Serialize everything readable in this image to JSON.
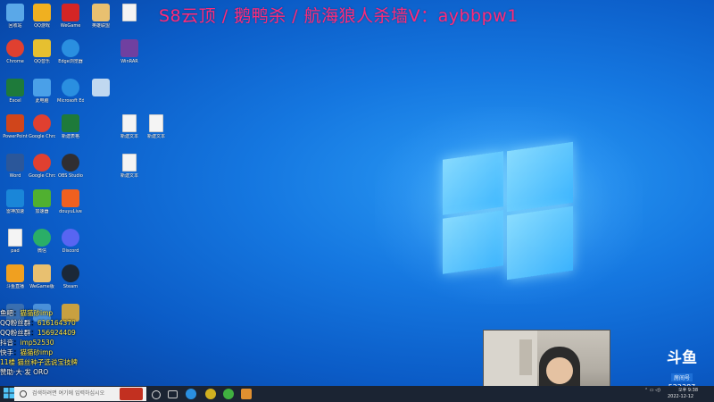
{
  "overlay": {
    "title": "S8云顶 / 鹅鸭杀 / 航海狼人杀墙V：aybbpw1",
    "lines": [
      {
        "label": "鱼吧",
        "value": "猫猫砂imp"
      },
      {
        "label": "QQ粉丝群",
        "value": "616164370"
      },
      {
        "label": "QQ粉丝群",
        "value": "156924409"
      },
      {
        "label": "抖音",
        "value": "imp52530"
      },
      {
        "label": "快手",
        "value": "猫猫砂imp"
      },
      {
        "label": "",
        "value": "11楼 猫丝种子选说宝技牌"
      },
      {
        "label": "",
        "value": "赞助·大·发 ORO"
      }
    ]
  },
  "desktop_icons": [
    {
      "name": "recycle-bin-icon",
      "label": "回收站",
      "color": "#5aa8e8"
    },
    {
      "name": "app-icon",
      "label": "QQ游戏",
      "color": "#f0b020"
    },
    {
      "name": "app-icon",
      "label": "WeGame",
      "color": "#d42525"
    },
    {
      "name": "app-icon",
      "label": "英雄联盟",
      "color": "#e8c070"
    },
    {
      "name": "file-icon",
      "label": "",
      "color": "#f4f4f4"
    },
    {
      "name": "chrome-icon",
      "label": "Chrome",
      "color": "#e04030"
    },
    {
      "name": "app-icon",
      "label": "QQ音乐",
      "color": "#e6c030"
    },
    {
      "name": "edge-icon",
      "label": "Edge浏览器",
      "color": "#2a8fe0"
    },
    {
      "name": "winrar-icon",
      "label": "WinRAR",
      "color": "#7040a0"
    },
    {
      "name": "excel-icon",
      "label": "Excel",
      "color": "#1e7a3a"
    },
    {
      "name": "computer-icon",
      "label": "此电脑",
      "color": "#4aa0e8"
    },
    {
      "name": "edge-icon",
      "label": "Microsoft Edge",
      "color": "#2a8fe0"
    },
    {
      "name": "app-icon",
      "label": "",
      "color": "#c0d8f0"
    },
    {
      "name": "powerpoint-icon",
      "label": "PowerPoint",
      "color": "#d0451b"
    },
    {
      "name": "chrome-icon",
      "label": "Google Chrome",
      "color": "#e04030"
    },
    {
      "name": "excel-icon",
      "label": "新建表格",
      "color": "#1e7a3a"
    },
    {
      "name": "file-icon",
      "label": "新建文本",
      "color": "#f4f4f4"
    },
    {
      "name": "file-icon",
      "label": "新建文本",
      "color": "#f4f4f4"
    },
    {
      "name": "word-icon",
      "label": "Word",
      "color": "#2b579a"
    },
    {
      "name": "chrome-icon",
      "label": "Google Chrome",
      "color": "#e04030"
    },
    {
      "name": "obs-icon",
      "label": "OBS Studio",
      "color": "#302e31"
    },
    {
      "name": "file-icon",
      "label": "新建文本",
      "color": "#f4f4f4"
    },
    {
      "name": "app-icon",
      "label": "雷神加速",
      "color": "#1a86d8"
    },
    {
      "name": "app-icon",
      "label": "加速器",
      "color": "#50b030"
    },
    {
      "name": "app-icon",
      "label": "douyuLive",
      "color": "#f06020"
    },
    {
      "name": "file-icon",
      "label": "pad",
      "color": "#f4f4f4"
    },
    {
      "name": "wechat-icon",
      "label": "微信",
      "color": "#2aae67"
    },
    {
      "name": "discord-icon",
      "label": "Discord",
      "color": "#5865f2"
    },
    {
      "name": "app-icon",
      "label": "斗鱼直播",
      "color": "#f0a020"
    },
    {
      "name": "app-icon",
      "label": "WeGame版",
      "color": "#e8c070"
    },
    {
      "name": "steam-icon",
      "label": "Steam",
      "color": "#1b2838"
    },
    {
      "name": "app-icon",
      "label": "",
      "color": "#3a6fb0"
    },
    {
      "name": "app-icon",
      "label": "",
      "color": "#4a90d9"
    },
    {
      "name": "app-icon",
      "label": "",
      "color": "#c8a040"
    }
  ],
  "taskbar": {
    "search_placeholder": "검색하려면 여기에 입력하십시오",
    "time": "오후 9:38",
    "date": "2022-12-12"
  },
  "douyu": {
    "logo": "斗鱼",
    "tag": "房间号",
    "room": "522387"
  }
}
